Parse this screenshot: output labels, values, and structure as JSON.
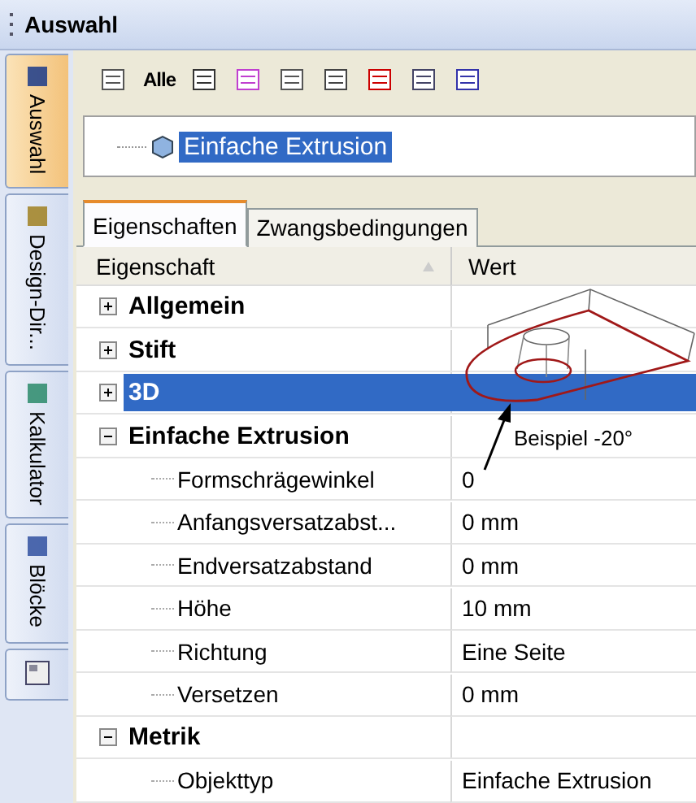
{
  "window": {
    "title": "Auswahl"
  },
  "side_tabs": [
    {
      "label": "Auswahl",
      "selected": true
    },
    {
      "label": "Design-Dir...",
      "selected": false
    },
    {
      "label": "Kalkulator",
      "selected": false
    },
    {
      "label": "Blöcke",
      "selected": false
    }
  ],
  "toolbar": {
    "all_button": "Alle"
  },
  "tree": {
    "item": "Einfache Extrusion",
    "selected": true
  },
  "tabs": [
    {
      "label": "Eigenschaften",
      "selected": true
    },
    {
      "label": "Zwangsbedingungen",
      "selected": false
    }
  ],
  "grid": {
    "columns": [
      "Eigenschaft",
      "Wert"
    ],
    "groups": [
      {
        "label": "Allgemein",
        "expanded": false,
        "selected": false
      },
      {
        "label": "Stift",
        "expanded": false,
        "selected": false
      },
      {
        "label": "3D",
        "expanded": false,
        "selected": true
      },
      {
        "label": "Einfache Extrusion",
        "expanded": true,
        "selected": false,
        "children": [
          {
            "label": "Formschrägewinkel",
            "value": "0"
          },
          {
            "label": "Anfangsversatzabst...",
            "value": "0 mm"
          },
          {
            "label": "Endversatzabstand",
            "value": "0 mm"
          },
          {
            "label": "Höhe",
            "value": "10 mm"
          },
          {
            "label": "Richtung",
            "value": "Eine Seite"
          },
          {
            "label": "Versetzen",
            "value": "0 mm"
          }
        ]
      },
      {
        "label": "Metrik",
        "expanded": true,
        "selected": false,
        "children": [
          {
            "label": "Objekttyp",
            "value": "Einfache Extrusion"
          }
        ]
      }
    ]
  },
  "annotation": "Beispiel -20°"
}
